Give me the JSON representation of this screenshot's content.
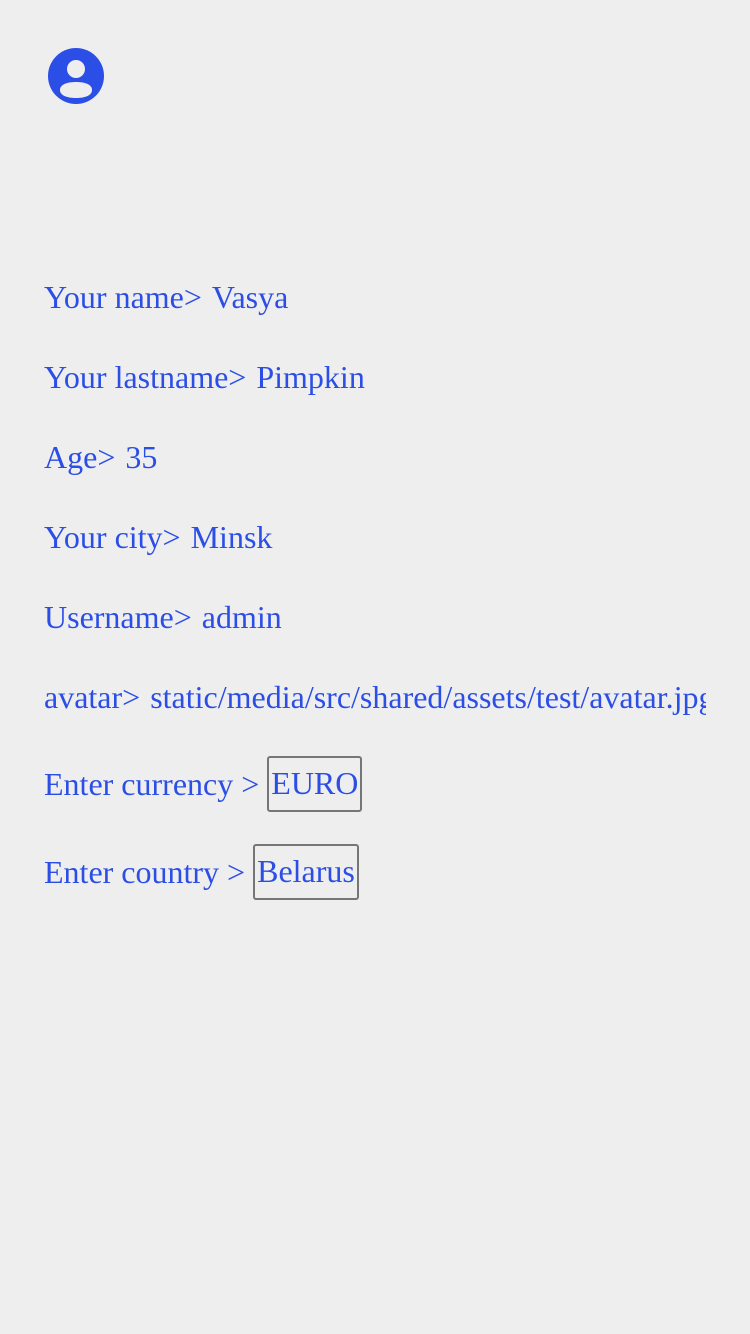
{
  "header": {
    "icon": "account-circle-icon",
    "icon_color": "#2b4ee6"
  },
  "profile": {
    "name_label": "Your name>",
    "name_value": "Vasya",
    "lastname_label": "Your lastname>",
    "lastname_value": "Pimpkin",
    "age_label": "Age>",
    "age_value": "35",
    "city_label": "Your city>",
    "city_value": "Minsk",
    "username_label": "Username>",
    "username_value": "admin",
    "avatar_label": "avatar>",
    "avatar_value": "static/media/src/shared/assets/test/avatar.jpg"
  },
  "form": {
    "currency_label": "Enter currency >",
    "currency_value": "EURO",
    "country_label": "Enter country >",
    "country_value": "Belarus"
  },
  "colors": {
    "background": "#eeeeee",
    "text": "#2b4ee6",
    "input_border": "#767676"
  }
}
